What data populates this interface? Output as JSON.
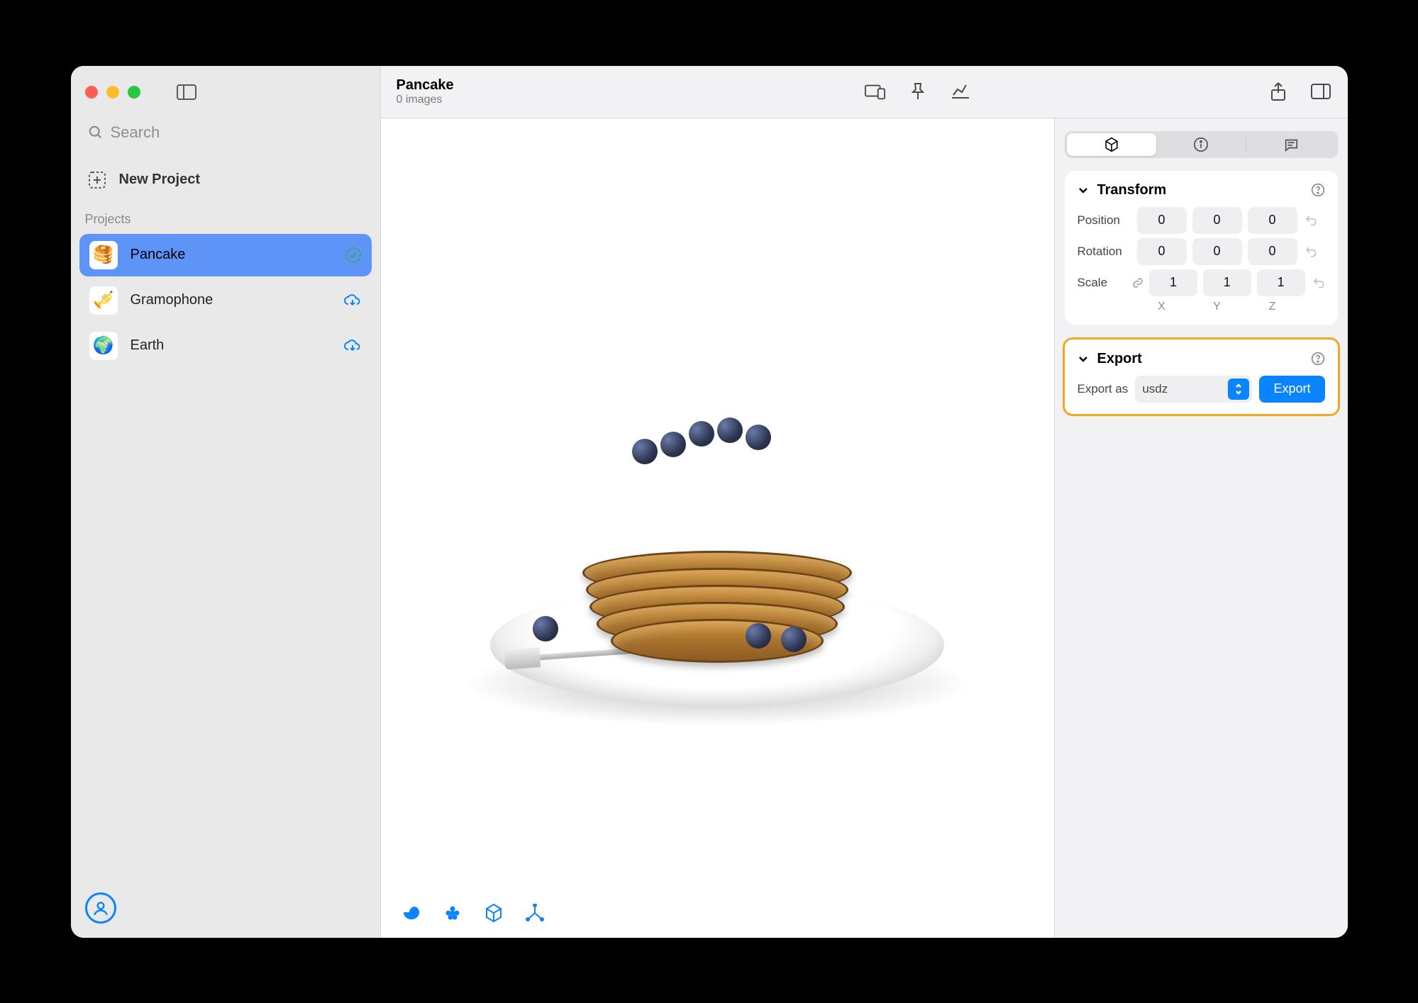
{
  "window": {
    "title": "Pancake",
    "subtitle": "0 images"
  },
  "sidebar": {
    "search_placeholder": "Search",
    "new_project_label": "New Project",
    "section_label": "Projects",
    "projects": [
      {
        "name": "Pancake",
        "status": "synced-green",
        "selected": true,
        "emoji": "🥞"
      },
      {
        "name": "Gramophone",
        "status": "cloud-down",
        "selected": false,
        "emoji": "🎺"
      },
      {
        "name": "Earth",
        "status": "cloud-down",
        "selected": false,
        "emoji": "🌍"
      }
    ]
  },
  "inspector": {
    "tabs": [
      "object",
      "info",
      "comments"
    ],
    "active_tab": "object",
    "transform": {
      "title": "Transform",
      "position_label": "Position",
      "rotation_label": "Rotation",
      "scale_label": "Scale",
      "axis": {
        "x": "X",
        "y": "Y",
        "z": "Z"
      },
      "position": {
        "x": "0",
        "y": "0",
        "z": "0"
      },
      "rotation": {
        "x": "0",
        "y": "0",
        "z": "0"
      },
      "scale": {
        "x": "1",
        "y": "1",
        "z": "1"
      }
    },
    "export": {
      "title": "Export",
      "label": "Export as",
      "format": "usdz",
      "button": "Export"
    }
  }
}
